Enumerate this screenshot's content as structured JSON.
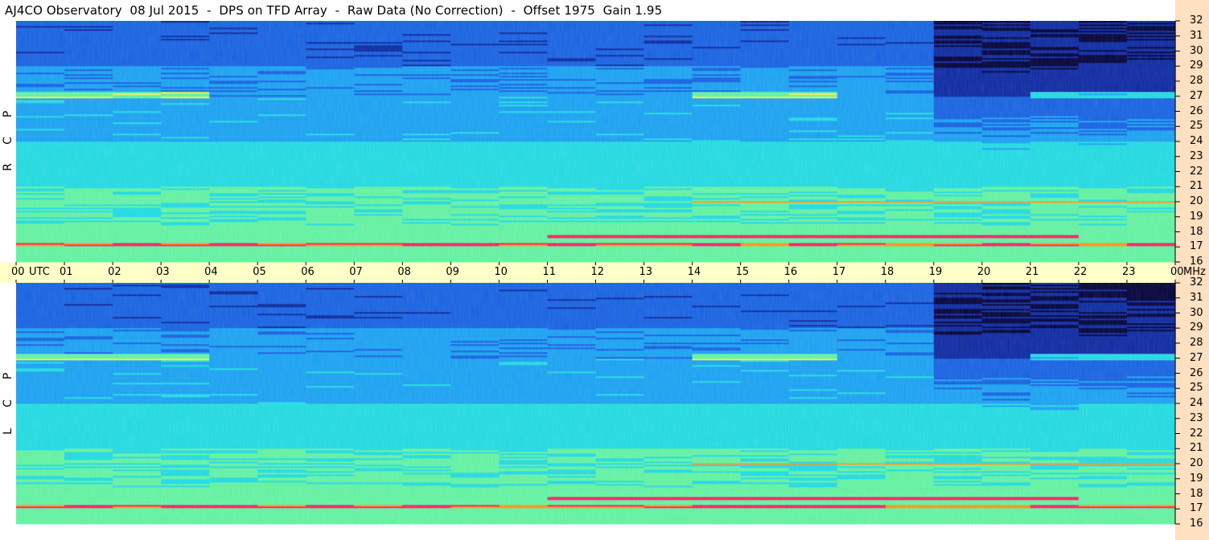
{
  "title": "AJ4CO Observatory  08 Jul 2015  -  DPS on TFD Array  -  Raw Data (No Correction)  -  Offset 1975  Gain 1.95",
  "chart_data": {
    "type": "heatmap",
    "x_unit": "UTC",
    "y_unit": "MHz",
    "x_ticks": [
      "00",
      "01",
      "02",
      "03",
      "04",
      "05",
      "06",
      "07",
      "08",
      "09",
      "10",
      "11",
      "12",
      "13",
      "14",
      "15",
      "16",
      "17",
      "18",
      "19",
      "20",
      "21",
      "22",
      "23",
      "00"
    ],
    "x_range_hours": [
      0,
      24
    ],
    "y_range_mhz": [
      16,
      32
    ],
    "y_ticks": [
      32,
      31,
      30,
      29,
      28,
      27,
      26,
      25,
      24,
      23,
      22,
      21,
      20,
      19,
      18,
      17,
      16
    ],
    "panels": [
      {
        "label_letters": [
          "R",
          "C",
          "P"
        ]
      },
      {
        "label_letters": [
          "L",
          "C",
          "P"
        ]
      }
    ],
    "colormap": [
      "#00003a",
      "#0a28a0",
      "#1560e0",
      "#18a0f0",
      "#20d8e0",
      "#60f0a0",
      "#e8f050",
      "#ff9020",
      "#ff2060"
    ]
  }
}
